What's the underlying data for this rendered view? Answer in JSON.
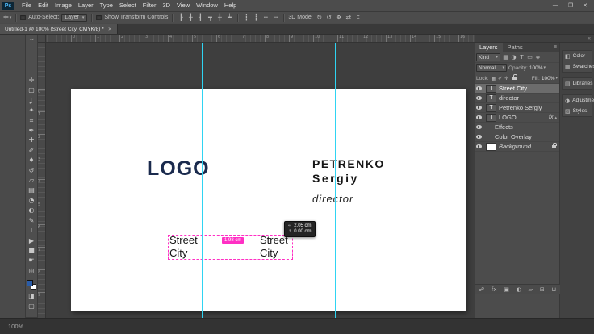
{
  "ui": {
    "dropdown_arrow": "▾"
  },
  "colors": {
    "guide": "#2fd4f2",
    "smart_guide": "#ff2fc4",
    "logo_text": "#1a2a4d"
  },
  "titlebar": {
    "logo_badge": "Ps",
    "menus": [
      "File",
      "Edit",
      "Image",
      "Layer",
      "Type",
      "Select",
      "Filter",
      "3D",
      "View",
      "Window",
      "Help"
    ],
    "window_controls": {
      "minimize": "—",
      "restore": "❐",
      "close": "✕"
    }
  },
  "options_bar": {
    "tool_icon": "✛",
    "auto_select_label": "Auto-Select:",
    "auto_select_value": "Layer",
    "show_transform_label": "Show Transform Controls",
    "align_icons": [
      {
        "name": "align-left-edges-icon",
        "glyph": "┠"
      },
      {
        "name": "align-horizontal-centers-icon",
        "glyph": "╂"
      },
      {
        "name": "align-right-edges-icon",
        "glyph": "┨"
      },
      {
        "name": "align-top-edges-icon",
        "glyph": "┯"
      },
      {
        "name": "align-vertical-centers-icon",
        "glyph": "╂"
      },
      {
        "name": "align-bottom-edges-icon",
        "glyph": "┷"
      }
    ],
    "distribute_icons": [
      {
        "name": "distribute-top-edges-icon",
        "glyph": "┇"
      },
      {
        "name": "distribute-vertical-centers-icon",
        "glyph": "┋"
      },
      {
        "name": "distribute-bottom-edges-icon",
        "glyph": "┅"
      },
      {
        "name": "distribute-left-edges-icon",
        "glyph": "┉"
      }
    ],
    "threed_label": "3D Mode:",
    "threed_icons": [
      {
        "name": "3d-rotate-icon",
        "glyph": "↻"
      },
      {
        "name": "3d-roll-icon",
        "glyph": "↺"
      },
      {
        "name": "3d-drag-icon",
        "glyph": "✥"
      },
      {
        "name": "3d-slide-icon",
        "glyph": "⇄"
      },
      {
        "name": "3d-scale-icon",
        "glyph": "↕"
      }
    ]
  },
  "tab_bar": {
    "active_tab": "Untitled-1 @ 100% (Street City, CMYK/8) *",
    "close_icon": "✕"
  },
  "toolbar": {
    "collapse_icon": "◂◂",
    "tools": [
      {
        "name": "move-tool",
        "glyph": "✛"
      },
      {
        "name": "rectangular-marquee-tool",
        "glyph": "▢"
      },
      {
        "name": "lasso-tool",
        "glyph": "ʆ"
      },
      {
        "name": "quick-selection-tool",
        "glyph": "✦"
      },
      {
        "name": "crop-tool",
        "glyph": "⌗"
      },
      {
        "name": "eyedropper-tool",
        "glyph": "✒"
      },
      {
        "name": "spot-healing-brush-tool",
        "glyph": "✚"
      },
      {
        "name": "brush-tool",
        "glyph": "✐"
      },
      {
        "name": "clone-stamp-tool",
        "glyph": "♦"
      },
      {
        "name": "history-brush-tool",
        "glyph": "↺"
      },
      {
        "name": "eraser-tool",
        "glyph": "▱"
      },
      {
        "name": "gradient-tool",
        "glyph": "▤"
      },
      {
        "name": "blur-tool",
        "glyph": "◔"
      },
      {
        "name": "dodge-tool",
        "glyph": "◐"
      },
      {
        "name": "pen-tool",
        "glyph": "✎"
      },
      {
        "name": "type-tool",
        "glyph": "T"
      },
      {
        "name": "path-selection-tool",
        "glyph": "▶"
      },
      {
        "name": "rectangle-tool",
        "glyph": "■"
      },
      {
        "name": "hand-tool",
        "glyph": "☛"
      },
      {
        "name": "zoom-tool",
        "glyph": "◎"
      }
    ],
    "extras": [
      {
        "name": "edit-in-quick-mask-button",
        "glyph": "◨"
      },
      {
        "name": "screen-mode-button",
        "glyph": "▢"
      }
    ],
    "foreground_color": "#2a5ca8",
    "background_color": "#ffffff"
  },
  "rulers": {
    "horizontal_numbers": [
      "0",
      "1",
      "2",
      "3",
      "4",
      "5",
      "6",
      "7",
      "8",
      "9",
      "10",
      "11",
      "12",
      "13",
      "14",
      "15",
      "16"
    ],
    "vertical_numbers": [
      "0",
      "1",
      "2",
      "3",
      "4",
      "5",
      "6",
      "7",
      "8",
      "9"
    ]
  },
  "canvas": {
    "logo": "LOGO",
    "name_upper": "PETRENKO",
    "name_lower": "Sergiy",
    "role": "director",
    "address_line1": "Street",
    "address_line2": "City",
    "measure_label": "1.98 cm",
    "hud": {
      "dx_icon": "↔",
      "dx_value": "2.05 cm",
      "dy_icon": "↕",
      "dy_value": "0.00 cm"
    }
  },
  "layers_panel": {
    "tabs": [
      {
        "label": "Layers",
        "active": true
      },
      {
        "label": "Paths",
        "active": false
      }
    ],
    "panel_menu_icon": "≡",
    "kind_value": "Kind",
    "filter_icons": [
      {
        "name": "filter-pixel-layers-icon",
        "glyph": "▦"
      },
      {
        "name": "filter-adjustment-layers-icon",
        "glyph": "◑"
      },
      {
        "name": "filter-type-layers-icon",
        "glyph": "T"
      },
      {
        "name": "filter-shape-layers-icon",
        "glyph": "▭"
      },
      {
        "name": "filter-smart-objects-icon",
        "glyph": "◈"
      }
    ],
    "blend_mode": "Normal",
    "opacity_label": "Opacity:",
    "opacity_value": "100%",
    "lock_label": "Lock:",
    "lock_icons": [
      {
        "name": "lock-transparent-pixels-icon",
        "glyph": "▦"
      },
      {
        "name": "lock-image-pixels-icon",
        "glyph": "✐"
      },
      {
        "name": "lock-position-icon",
        "glyph": "✛"
      }
    ],
    "fill_label": "Fill:",
    "fill_value": "100%",
    "rows": [
      {
        "name": "Street City",
        "kind": "text",
        "selected": true
      },
      {
        "name": "director",
        "kind": "text",
        "selected": false
      },
      {
        "name": "Petrenko Sergiy",
        "kind": "text",
        "selected": false
      },
      {
        "name": "LOGO",
        "kind": "text",
        "selected": false,
        "fx_label": "fx",
        "fx_arrow": "▴"
      },
      {
        "name": "Effects",
        "kind": "effects",
        "selected": false
      },
      {
        "name": "Color Overlay",
        "kind": "effect",
        "selected": false
      },
      {
        "name": "Background",
        "kind": "background",
        "selected": false,
        "locked": true
      }
    ],
    "bottom_icons": [
      {
        "name": "link-layers-icon",
        "glyph": "☍"
      },
      {
        "name": "layer-style-icon",
        "glyph": "fx"
      },
      {
        "name": "layer-mask-icon",
        "glyph": "▣"
      },
      {
        "name": "adjustment-layer-icon",
        "glyph": "◐"
      },
      {
        "name": "layer-group-icon",
        "glyph": "▱"
      },
      {
        "name": "new-layer-icon",
        "glyph": "⊞"
      },
      {
        "name": "delete-layer-icon",
        "glyph": "⊔"
      }
    ]
  },
  "right_rail": {
    "collapse_icon": "«",
    "groups": [
      {
        "items": [
          {
            "name": "panel-color",
            "icon": "◧",
            "label": "Color"
          },
          {
            "name": "panel-swatches",
            "icon": "▦",
            "label": "Swatches"
          }
        ]
      },
      {
        "items": [
          {
            "name": "panel-libraries",
            "icon": "▤",
            "label": "Libraries"
          }
        ]
      },
      {
        "items": [
          {
            "name": "panel-adjustments",
            "icon": "◑",
            "label": "Adjustments"
          },
          {
            "name": "panel-styles",
            "icon": "▨",
            "label": "Styles"
          }
        ]
      }
    ]
  },
  "status_bar": {
    "zoom": "100%"
  }
}
